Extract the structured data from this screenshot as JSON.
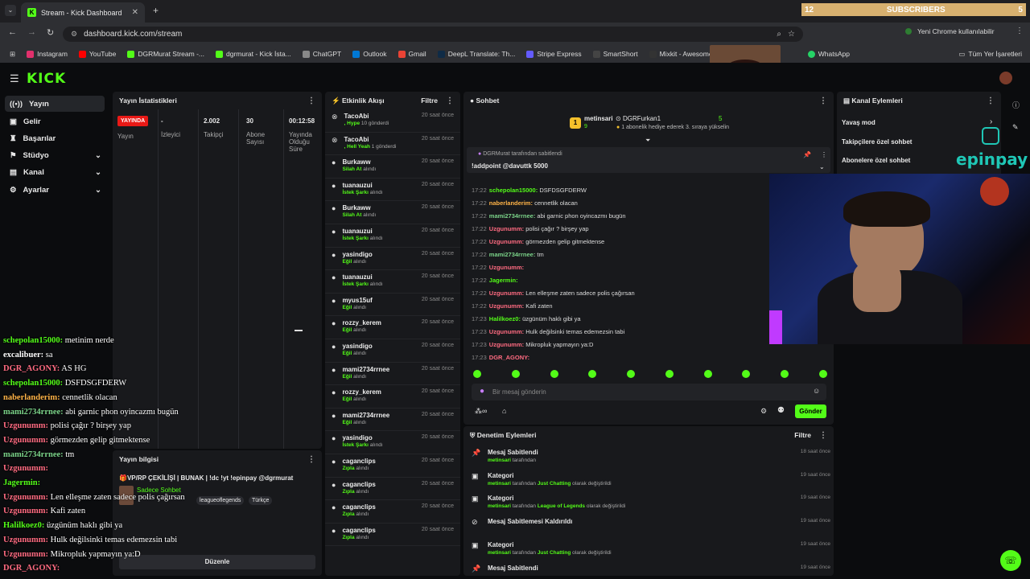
{
  "browser": {
    "tab_title": "Stream - Kick Dashboard",
    "url": "dashboard.kick.com/stream",
    "profile_button": "Yeni Chrome kullanılabilir",
    "bookmarks": [
      "Instagram",
      "YouTube",
      "DGRMurat Stream -...",
      "dgrmurat - Kick İsta...",
      "ChatGPT",
      "Outlook",
      "Gmail",
      "DeepL Translate: Th...",
      "Stripe Express",
      "SmartShort",
      "Mixkit - Awesome fr...",
      "WhatsApp"
    ],
    "all_bookmarks": "Tüm Yer İşaretleri"
  },
  "overlay": {
    "subs_left": "12",
    "subs_label": "SUBSCRIBERS",
    "subs_right": "5",
    "epinpay": "epinpay"
  },
  "sidebar": {
    "items": [
      {
        "label": "Yayın"
      },
      {
        "label": "Gelir"
      },
      {
        "label": "Başarılar"
      },
      {
        "label": "Stüdyo"
      },
      {
        "label": "Kanal"
      },
      {
        "label": "Ayarlar"
      }
    ]
  },
  "stats": {
    "title": "Yayın İstatistikleri",
    "live_badge": "YAYINDA",
    "cols": [
      {
        "value": "-",
        "label": "İzleyici"
      },
      {
        "value": "2.002",
        "label": "Takipçi"
      },
      {
        "value": "30",
        "label": "Abone Sayısı"
      },
      {
        "value": "00:12:58",
        "label": "Yayında Olduğu Süre"
      }
    ],
    "live_label": "Yayın"
  },
  "info": {
    "title": "Yayın bilgisi",
    "stream_title": "🎁VP/RP ÇEKİLİŞİ | BUNAK | !dc !yt !epinpay @dgrmurat",
    "category": "Sadece Sohbet",
    "tags": [
      "leagueoflegends",
      "Türkçe"
    ],
    "edit_button": "Düzenle"
  },
  "activity": {
    "title": "Etkinlik Akışı",
    "filter": "Filtre",
    "events": [
      {
        "name": "TacoAbi",
        "action": ", Hype",
        "extra": "10 gönderdi",
        "time": "20 saat önce"
      },
      {
        "name": "TacoAbi",
        "action": ", Hell Yeah",
        "extra": "1 gönderdi",
        "time": "20 saat önce"
      },
      {
        "name": "Burkaww",
        "action": "Silah At",
        "extra": "alındı",
        "time": "20 saat önce"
      },
      {
        "name": "tuanauzui",
        "action": "İstek Şarkı",
        "extra": "alındı",
        "time": "20 saat önce"
      },
      {
        "name": "Burkaww",
        "action": "Silah At",
        "extra": "alındı",
        "time": "20 saat önce"
      },
      {
        "name": "tuanauzui",
        "action": "İstek Şarkı",
        "extra": "alındı",
        "time": "20 saat önce"
      },
      {
        "name": "yasindigo",
        "action": "Eğil",
        "extra": "alındı",
        "time": "20 saat önce"
      },
      {
        "name": "tuanauzui",
        "action": "İstek Şarkı",
        "extra": "alındı",
        "time": "20 saat önce"
      },
      {
        "name": "myus15uf",
        "action": "Eğil",
        "extra": "alındı",
        "time": "20 saat önce"
      },
      {
        "name": "rozzy_kerem",
        "action": "Eğil",
        "extra": "alındı",
        "time": "20 saat önce"
      },
      {
        "name": "yasindigo",
        "action": "Eğil",
        "extra": "alındı",
        "time": "20 saat önce"
      },
      {
        "name": "mami2734rrnee",
        "action": "Eğil",
        "extra": "alındı",
        "time": "20 saat önce"
      },
      {
        "name": "rozzy_kerem",
        "action": "Eğil",
        "extra": "alındı",
        "time": "20 saat önce"
      },
      {
        "name": "mami2734rrnee",
        "action": "Eğil",
        "extra": "alındı",
        "time": "20 saat önce"
      },
      {
        "name": "yasindigo",
        "action": "İstek Şarkı",
        "extra": "alındı",
        "time": "20 saat önce"
      },
      {
        "name": "caganclips",
        "action": "Zıpla",
        "extra": "alındı",
        "time": "20 saat önce"
      },
      {
        "name": "caganclips",
        "action": "Zıpla",
        "extra": "alındı",
        "time": "20 saat önce"
      },
      {
        "name": "caganclips",
        "action": "Zıpla",
        "extra": "alındı",
        "time": "20 saat önce"
      },
      {
        "name": "caganclips",
        "action": "Zıpla",
        "extra": "alındı",
        "time": "20 saat önce"
      }
    ]
  },
  "chat": {
    "title": "Sohbet",
    "gift_from": "metinsari",
    "gift_count": "9",
    "gift_to": "DGRFurkan1",
    "gift_num": "5",
    "gift_text": "1 abonelik hediye ederek 3. sıraya yükselin",
    "pinned_by": "DGRMurat tarafından sabitlendi",
    "pinned_msg": "!addpoint @davuttk 5000",
    "messages": [
      {
        "time": "17:22",
        "user": "schepolan15000:",
        "msg": "DSFDSGFDERW",
        "color": "#53fc18"
      },
      {
        "time": "17:22",
        "user": "naberlanderim:",
        "msg": "cennetlik olacan",
        "color": "#ffb347"
      },
      {
        "time": "17:22",
        "user": "mami2734rrnee:",
        "msg": "abi garnic phon oyincazmı bugün",
        "color": "#7bd389"
      },
      {
        "time": "17:22",
        "user": "Uzgunumm:",
        "msg": "polisi çağır ? birşey yap",
        "color": "#ff6b81"
      },
      {
        "time": "17:22",
        "user": "Uzgunumm:",
        "msg": "görmezden gelip gitmektense",
        "color": "#ff6b81"
      },
      {
        "time": "17:22",
        "user": "mami2734rrnee:",
        "msg": "tm",
        "color": "#7bd389"
      },
      {
        "time": "17:22",
        "user": "Uzgunumm:",
        "msg": "",
        "color": "#ff6b81"
      },
      {
        "time": "17:22",
        "user": "Jagermin:",
        "msg": "",
        "color": "#53fc18"
      },
      {
        "time": "17:22",
        "user": "Uzgunumm:",
        "msg": "Len elleşme zaten sadece polis çağırsan",
        "color": "#ff6b81"
      },
      {
        "time": "17:22",
        "user": "Uzgunumm:",
        "msg": "Kafi zaten",
        "color": "#ff6b81"
      },
      {
        "time": "17:23",
        "user": "Halilkoez0:",
        "msg": "üzgünüm haklı gibi ya",
        "color": "#53fc18"
      },
      {
        "time": "17:23",
        "user": "Uzgunumm:",
        "msg": "Hulk değilsinki temas edemezsin tabi",
        "color": "#ff6b81"
      },
      {
        "time": "17:23",
        "user": "Uzgunumm:",
        "msg": "Mikropluk yapmayın ya:D",
        "color": "#ff6b81"
      },
      {
        "time": "17:23",
        "user": "DGR_AGONY:",
        "msg": "",
        "color": "#ff6b81"
      }
    ],
    "input_placeholder": "Bir mesaj gönderin",
    "send_button": "Gönder"
  },
  "overlay_chat": [
    {
      "user": "schepolan15000:",
      "msg": "metinim nerde",
      "color": "#53fc18"
    },
    {
      "user": "excalibuer:",
      "msg": "sa",
      "color": "#ffffff"
    },
    {
      "user": "DGR_AGONY:",
      "msg": "AS HG",
      "color": "#ff6b81"
    },
    {
      "user": "schepolan15000:",
      "msg": "DSFDSGFDERW",
      "color": "#53fc18"
    },
    {
      "user": "naberlanderim:",
      "msg": "cennetlik olacan",
      "color": "#ffb347"
    },
    {
      "user": "mami2734rrnee:",
      "msg": "abi garnic phon oyincazmı bugün",
      "color": "#7bd389"
    },
    {
      "user": "Uzgunumm:",
      "msg": "polisi çağır ? birşey yap",
      "color": "#ff6b81"
    },
    {
      "user": "Uzgunumm:",
      "msg": "görmezden gelip gitmektense",
      "color": "#ff6b81"
    },
    {
      "user": "mami2734rrnee:",
      "msg": "tm",
      "color": "#7bd389"
    },
    {
      "user": "Uzgunumm:",
      "msg": "",
      "color": "#ff6b81"
    },
    {
      "user": "Jagermin:",
      "msg": "",
      "color": "#53fc18"
    },
    {
      "user": "Uzgunumm:",
      "msg": "Len elleşme zaten sadece polis çağırsan",
      "color": "#ff6b81"
    },
    {
      "user": "Uzgunumm:",
      "msg": "Kafi zaten",
      "color": "#ff6b81"
    },
    {
      "user": "Halilkoez0:",
      "msg": "üzgünüm haklı gibi ya",
      "color": "#53fc18"
    },
    {
      "user": "Uzgunumm:",
      "msg": "Hulk değilsinki temas edemezsin tabi",
      "color": "#ff6b81"
    },
    {
      "user": "Uzgunumm:",
      "msg": "Mikropluk yapmayın ya:D",
      "color": "#ff6b81"
    },
    {
      "user": "DGR_AGONY:",
      "msg": "",
      "color": "#ff6b81"
    }
  ],
  "moderation": {
    "title": "Denetim Eylemleri",
    "filter": "Filtre",
    "items": [
      {
        "title": "Mesaj Sabitlendi",
        "user": "metinsari",
        "rest": "tarafından",
        "bold": "",
        "suffix": "",
        "time": "18 saat önce"
      },
      {
        "title": "Kategori",
        "user": "metinsari",
        "rest": "tarafından",
        "bold": "Just Chatting",
        "suffix": "olarak değiştirildi",
        "time": "19 saat önce"
      },
      {
        "title": "Kategori",
        "user": "metinsari",
        "rest": "tarafından",
        "bold": "League of Legends",
        "suffix": "olarak değiştirildi",
        "time": "19 saat önce"
      },
      {
        "title": "Mesaj Sabitlemesi Kaldırıldı",
        "user": "",
        "rest": "",
        "bold": "",
        "suffix": "",
        "time": "19 saat önce"
      },
      {
        "title": "Kategori",
        "user": "metinsari",
        "rest": "tarafından",
        "bold": "Just Chatting",
        "suffix": "olarak değiştirildi",
        "time": "19 saat önce"
      },
      {
        "title": "Mesaj Sabitlendi",
        "user": "",
        "rest": "",
        "bold": "",
        "suffix": "",
        "time": "19 saat önce"
      }
    ]
  },
  "channel": {
    "title": "Kanal Eylemleri",
    "actions": [
      "Yavaş mod",
      "Takipçilere özel sohbet",
      "Abonelere özel sohbet"
    ]
  }
}
